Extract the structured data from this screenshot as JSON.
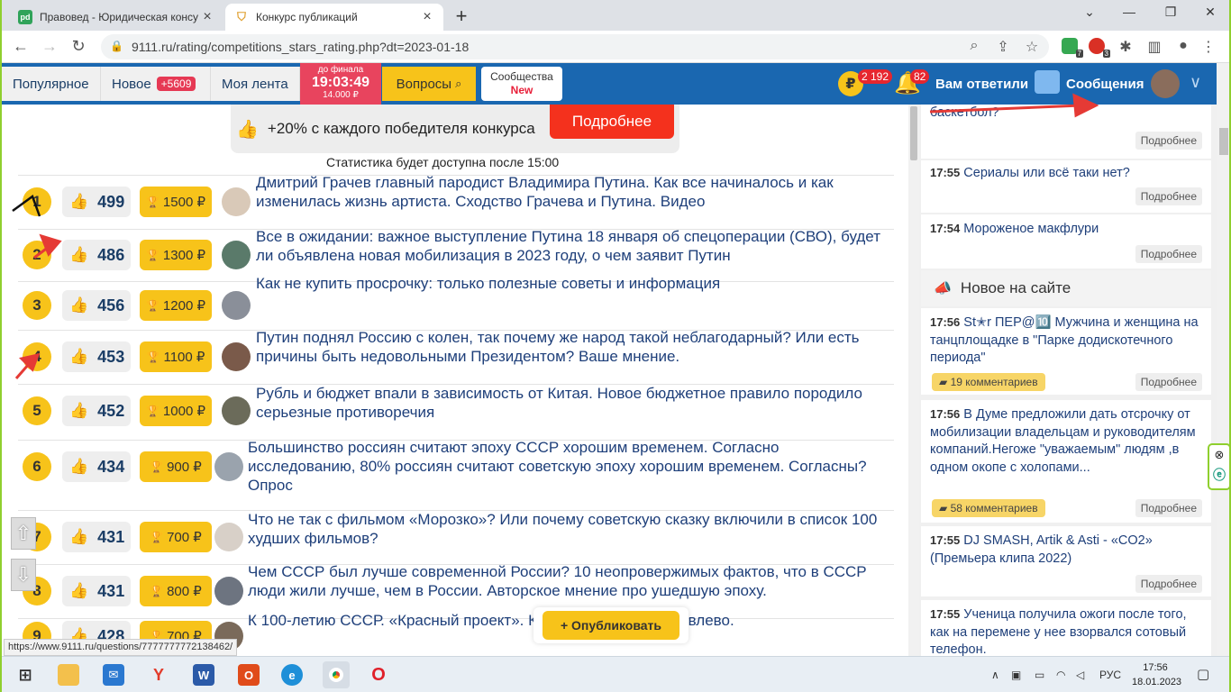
{
  "browser": {
    "tabs": [
      {
        "title": "Правовед - Юридическая консу",
        "favicon": "pd",
        "color": "#30a35a"
      },
      {
        "title": "Конкурс публикаций",
        "favicon": "shield",
        "color": "#e0a030"
      }
    ],
    "url": "9111.ru/rating/competitions_stars_rating.php?dt=2023-01-18",
    "ext_badges": [
      "7",
      "3"
    ]
  },
  "header": {
    "popular": "Популярное",
    "new_label": "Новое",
    "new_count": "+5609",
    "feed": "Моя лента",
    "timer_top": "до финала",
    "timer_time": "19:03:49",
    "timer_bottom": "14.000 ₽",
    "questions": "Вопросы",
    "community": "Сообщества",
    "community_new": "New",
    "ruble": "₽",
    "balance": "2 192",
    "notif_count": "82",
    "answered": "Вам ответили",
    "messages": "Сообщения"
  },
  "promo": {
    "text": "+20% с каждого победителя конкурса",
    "button": "Подробнее"
  },
  "stats_note": "Статистика будет доступна после 15:00",
  "rating": [
    {
      "rank": "1",
      "votes": "499",
      "prize": "1500 ₽",
      "title": "Дмитрий Грачев главный пародист Владимира Путина. Как все начиналось и как изменилась жизнь артиста. Сходство Грачева и Путина. Видео",
      "avatar": "#d9c9b8"
    },
    {
      "rank": "2",
      "votes": "486",
      "prize": "1300 ₽",
      "title": "Все в ожидании: важное выступление Путина 18 января об спецоперации (СВО), будет ли объявлена новая мобилизация в 2023 году, о чем заявит Путин",
      "avatar": "#5a7a6a"
    },
    {
      "rank": "3",
      "votes": "456",
      "prize": "1200 ₽",
      "title": "Как не купить просрочку: только полезные советы и информация",
      "avatar": "#8a8f99"
    },
    {
      "rank": "4",
      "votes": "453",
      "prize": "1100 ₽",
      "title": "Путин поднял Россию с колен, так почему же народ такой неблагодарный? Или есть причины быть недовольными Президентом? Ваше мнение.",
      "avatar": "#7a5a4a"
    },
    {
      "rank": "5",
      "votes": "452",
      "prize": "1000 ₽",
      "title": "Рубль и бюджет впали в зависимость от Китая. Новое бюджетное правило породило серьезные противоречия",
      "avatar": "#6b6b5a"
    },
    {
      "rank": "6",
      "votes": "434",
      "prize": "900 ₽",
      "title": "Большинство россиян считают эпоху СССР хорошим временем. Согласно исследованию, 80% россиян считают советскую эпоху хорошим временем. Согласны? Опрос",
      "avatar": "#9aa3ad"
    },
    {
      "rank": "7",
      "votes": "431",
      "prize": "700 ₽",
      "title": "Что не так с фильмом «Морозко»? Или почему советскую сказку включили в список 100 худших фильмов?",
      "avatar": "#d8d0c8"
    },
    {
      "rank": "8",
      "votes": "431",
      "prize": "800 ₽",
      "title": "Чем СССР был лучше современной России? 10 неопровержимых фактов, что в СССР люди жили лучше, чем в России. Авторское мнение про ушедшую эпоху.",
      "avatar": "#6d7480"
    },
    {
      "rank": "9",
      "votes": "428",
      "prize": "700 ₽",
      "title": "К 100-летию СССР. «Красный проект». Кремль поворачивает влево.",
      "avatar": "#7a6a5a"
    }
  ],
  "publish_button": "+ Опубликовать",
  "status_url": "https://www.9111.ru/questions/7777777772138462/",
  "sidebar": {
    "more": "Подробнее",
    "top_items": [
      {
        "time": "",
        "title": "баскетбол?"
      },
      {
        "time": "17:55",
        "title": "Сериалы или всё таки нет?"
      },
      {
        "time": "17:54",
        "title": "Мороженое макфлури"
      }
    ],
    "new_header": "Новое на сайте",
    "new_items": [
      {
        "time": "17:56",
        "title": "St✭r ПЕР@🔟 Мужчина и женщина на танцплощадке в \"Парке додискотечного периода\"",
        "comments": "19 комментариев"
      },
      {
        "time": "17:56",
        "title": "В Думе предложили дать отсрочку от мобилизации владельцам и руководителям компаний.Негоже \"уважаемым\" людям ,в одном окопе с холопами...",
        "comments": "58 комментариев"
      },
      {
        "time": "17:55",
        "title": "DJ SMASH, Artik & Asti - «CO2» (Премьера клипа 2022)",
        "comments": ""
      },
      {
        "time": "17:55",
        "title": "Ученица получила ожоги после того, как на перемене у нее взорвался сотовый телефон.",
        "comments": ""
      }
    ]
  },
  "taskbar": {
    "lang": "РУС",
    "time": "17:56",
    "date": "18.01.2023"
  }
}
